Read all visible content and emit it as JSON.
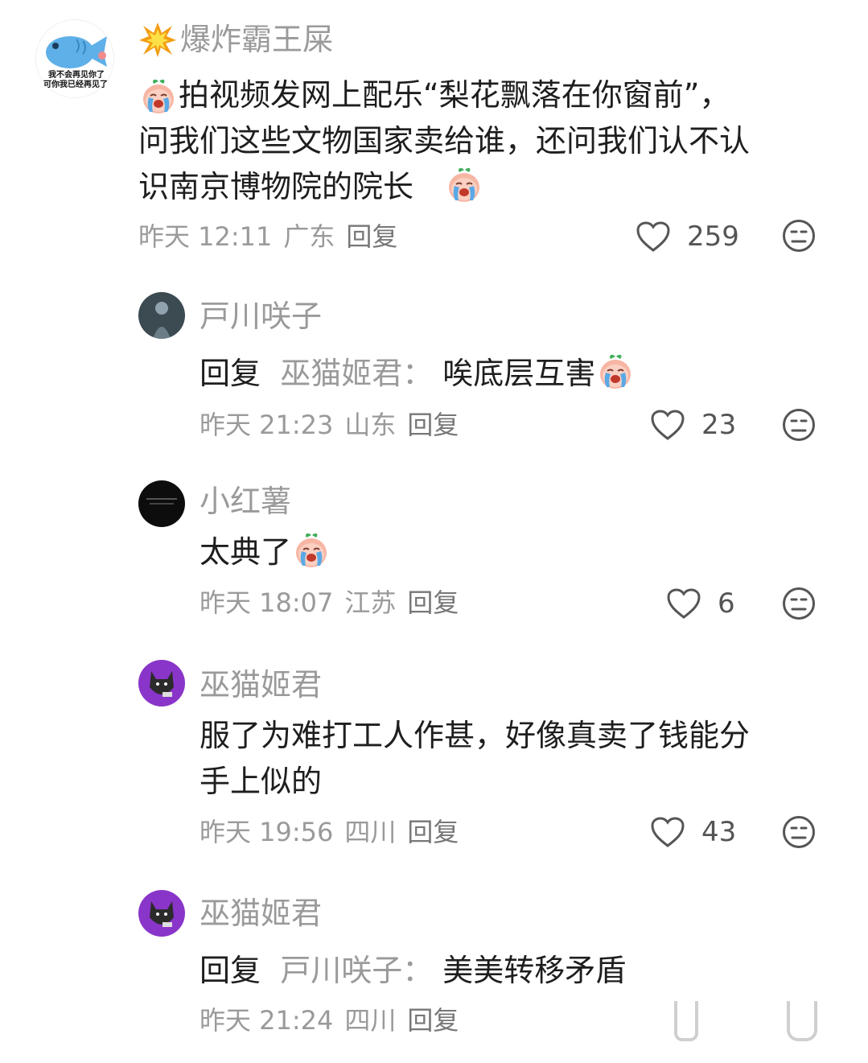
{
  "comments": [
    {
      "username": "爆炸霸王屎",
      "avatar_caption_1": "我不会再见你了",
      "avatar_caption_2": "可你我已经再见了",
      "text_line1": "拍视频发网上配乐“梨花飘落在你窗前”，",
      "text_line2": "问我们这些文物国家卖给谁，还问我们认不认",
      "text_line3": "识南京博物院的院长",
      "time": "昨天 12:11",
      "location": "广东",
      "reply_label": "回复",
      "likes": "259"
    },
    {
      "username": "戸川咲子",
      "reply_prefix": "回复",
      "reply_to": "巫猫姬君：",
      "text": "唉底层互害",
      "time": "昨天 21:23",
      "location": "山东",
      "reply_label": "回复",
      "likes": "23"
    },
    {
      "username": "小红薯",
      "text": "太典了",
      "time": "昨天 18:07",
      "location": "江苏",
      "reply_label": "回复",
      "likes": "6"
    },
    {
      "username": "巫猫姬君",
      "text_line1": "服了为难打工人作甚，好像真卖了钱能分",
      "text_line2": "手上似的",
      "time": "昨天 19:56",
      "location": "四川",
      "reply_label": "回复",
      "likes": "43"
    },
    {
      "username": "巫猫姬君",
      "reply_prefix": "回复",
      "reply_to": "戸川咲子：",
      "text": "美美转移矛盾",
      "time": "昨天 21:24",
      "location": "四川",
      "reply_label": "回复"
    }
  ],
  "icons": {
    "like": "heart-outline-icon",
    "dislike": "meh-face-icon",
    "emoji": "crying-peach-emoji"
  },
  "colors": {
    "username": "#9a9a9a",
    "text": "#1e1e1e",
    "meta": "#9a9a9a",
    "avatar_purple": "#8a35c9"
  }
}
